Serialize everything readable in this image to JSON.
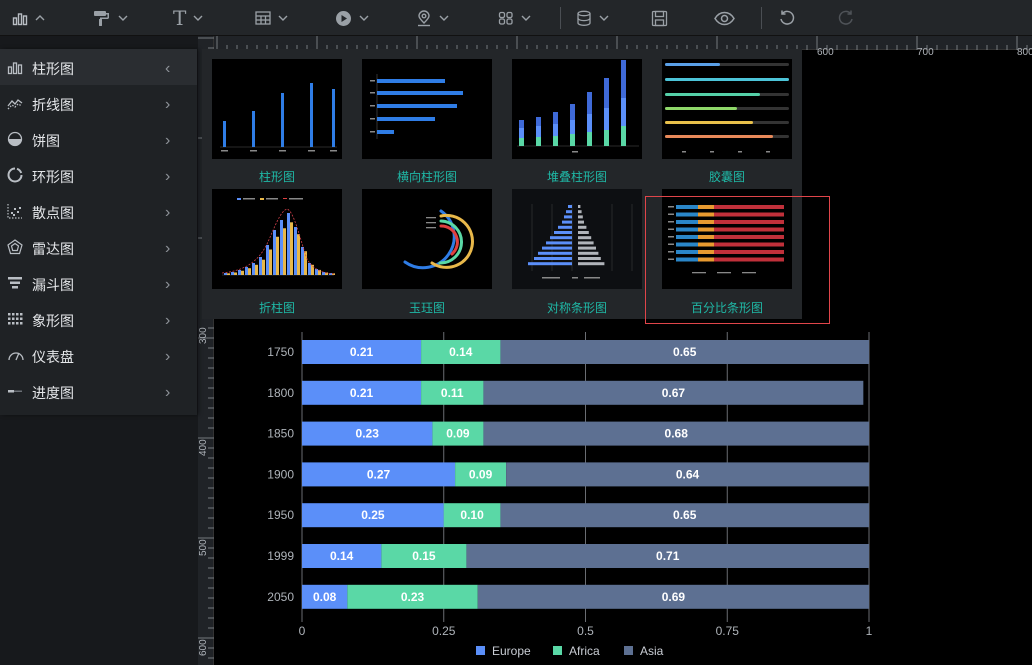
{
  "toolbar": {
    "items": [
      "chart-icon",
      "paint-roller-icon",
      "text-icon",
      "table-icon",
      "media-icon",
      "location-icon",
      "grid-icon",
      "database-icon",
      "save-icon",
      "eye-icon",
      "undo-icon",
      "redo-icon"
    ],
    "text_tool_glyph": "T"
  },
  "ruler": {
    "top_labels": [
      "600",
      "700",
      "800"
    ],
    "left_labels": [
      "300",
      "400",
      "500",
      "600"
    ]
  },
  "menu": {
    "items": [
      {
        "label": "柱形图",
        "icon": "bar-chart-icon",
        "active": true,
        "arrow": "‹"
      },
      {
        "label": "折线图",
        "icon": "line-chart-icon",
        "active": false,
        "arrow": "›"
      },
      {
        "label": "饼图",
        "icon": "pie-chart-icon",
        "active": false,
        "arrow": "›"
      },
      {
        "label": "环形图",
        "icon": "ring-chart-icon",
        "active": false,
        "arrow": "›"
      },
      {
        "label": "散点图",
        "icon": "scatter-chart-icon",
        "active": false,
        "arrow": "›"
      },
      {
        "label": "雷达图",
        "icon": "radar-chart-icon",
        "active": false,
        "arrow": "›"
      },
      {
        "label": "漏斗图",
        "icon": "funnel-chart-icon",
        "active": false,
        "arrow": "›"
      },
      {
        "label": "象形图",
        "icon": "pictorial-chart-icon",
        "active": false,
        "arrow": "›"
      },
      {
        "label": "仪表盘",
        "icon": "gauge-icon",
        "active": false,
        "arrow": "›"
      },
      {
        "label": "进度图",
        "icon": "progress-icon",
        "active": false,
        "arrow": "›"
      }
    ]
  },
  "flyout": {
    "items": [
      {
        "label": "柱形图",
        "kind": "column"
      },
      {
        "label": "横向柱形图",
        "kind": "hbar"
      },
      {
        "label": "堆叠柱形图",
        "kind": "stacked"
      },
      {
        "label": "胶囊图",
        "kind": "capsule"
      },
      {
        "label": "折柱图",
        "kind": "linebar"
      },
      {
        "label": "玉珏图",
        "kind": "ring"
      },
      {
        "label": "对称条形图",
        "kind": "symmetric"
      },
      {
        "label": "百分比条形图",
        "kind": "percent",
        "selected": true
      }
    ]
  },
  "colors": {
    "europe": "#5b8ff9",
    "africa": "#5ad8a6",
    "asia": "#5d7092",
    "teal_label": "#1fb8a6",
    "highlight": "#e0454a"
  },
  "chart_data": {
    "type": "bar",
    "orientation": "horizontal",
    "stacked": true,
    "categories": [
      "1750",
      "1800",
      "1850",
      "1900",
      "1950",
      "1999",
      "2050"
    ],
    "series": [
      {
        "name": "Europe",
        "color": "#5b8ff9",
        "values": [
          0.21,
          0.21,
          0.23,
          0.27,
          0.25,
          0.14,
          0.08
        ]
      },
      {
        "name": "Africa",
        "color": "#5ad8a6",
        "values": [
          0.14,
          0.11,
          0.09,
          0.09,
          0.1,
          0.15,
          0.23
        ]
      },
      {
        "name": "Asia",
        "color": "#5d7092",
        "values": [
          0.65,
          0.67,
          0.68,
          0.64,
          0.65,
          0.71,
          0.69
        ]
      }
    ],
    "x_ticks": [
      "0",
      "0.25",
      "0.5",
      "0.75",
      "1"
    ],
    "xlim": [
      0,
      1
    ],
    "grid": true,
    "legend": "bottom"
  }
}
